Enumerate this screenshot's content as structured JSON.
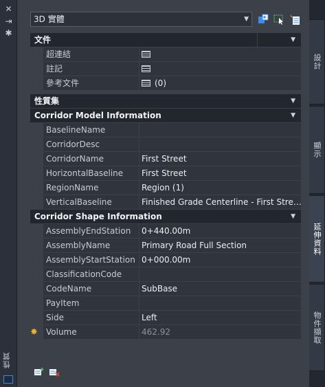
{
  "panel": {
    "title": "性質",
    "object_type": "3D 實體"
  },
  "tabs": [
    {
      "label": "設計"
    },
    {
      "label": "顯示"
    },
    {
      "label": "延伸資料"
    },
    {
      "label": "物件擷取"
    }
  ],
  "sections": {
    "document": {
      "title": "文件",
      "rows": [
        {
          "name": "超連結",
          "value": ""
        },
        {
          "name": "註記",
          "value": ""
        },
        {
          "name": "參考文件",
          "value": "(0)"
        }
      ]
    },
    "property_set": {
      "title": "性質集"
    },
    "corridor_model": {
      "title": "Corridor Model Information",
      "rows": [
        {
          "name": "BaselineName",
          "value": ""
        },
        {
          "name": "CorridorDesc",
          "value": ""
        },
        {
          "name": "CorridorName",
          "value": "First Street"
        },
        {
          "name": "HorizontalBaseline",
          "value": "First Street"
        },
        {
          "name": "RegionName",
          "value": "Region (1)"
        },
        {
          "name": "VerticalBaseline",
          "value": "Finished Grade Centerline - First Stre…"
        }
      ]
    },
    "corridor_shape": {
      "title": "Corridor Shape Information",
      "rows": [
        {
          "name": "AssemblyEndStation",
          "value": "0+440.00m"
        },
        {
          "name": "AssemblyName",
          "value": "Primary Road Full Section"
        },
        {
          "name": "AssemblyStartStation",
          "value": "0+000.00m"
        },
        {
          "name": "ClassificationCode",
          "value": ""
        },
        {
          "name": "CodeName",
          "value": "SubBase"
        },
        {
          "name": "PayItem",
          "value": ""
        },
        {
          "name": "Side",
          "value": "Left"
        },
        {
          "name": "Volume",
          "value": "462.92"
        }
      ]
    }
  },
  "colors": {
    "panel_bg": "#3b4049",
    "category_bg": "#22262d",
    "row_bg": "#2f343d",
    "accent": "#3a8ee6"
  }
}
